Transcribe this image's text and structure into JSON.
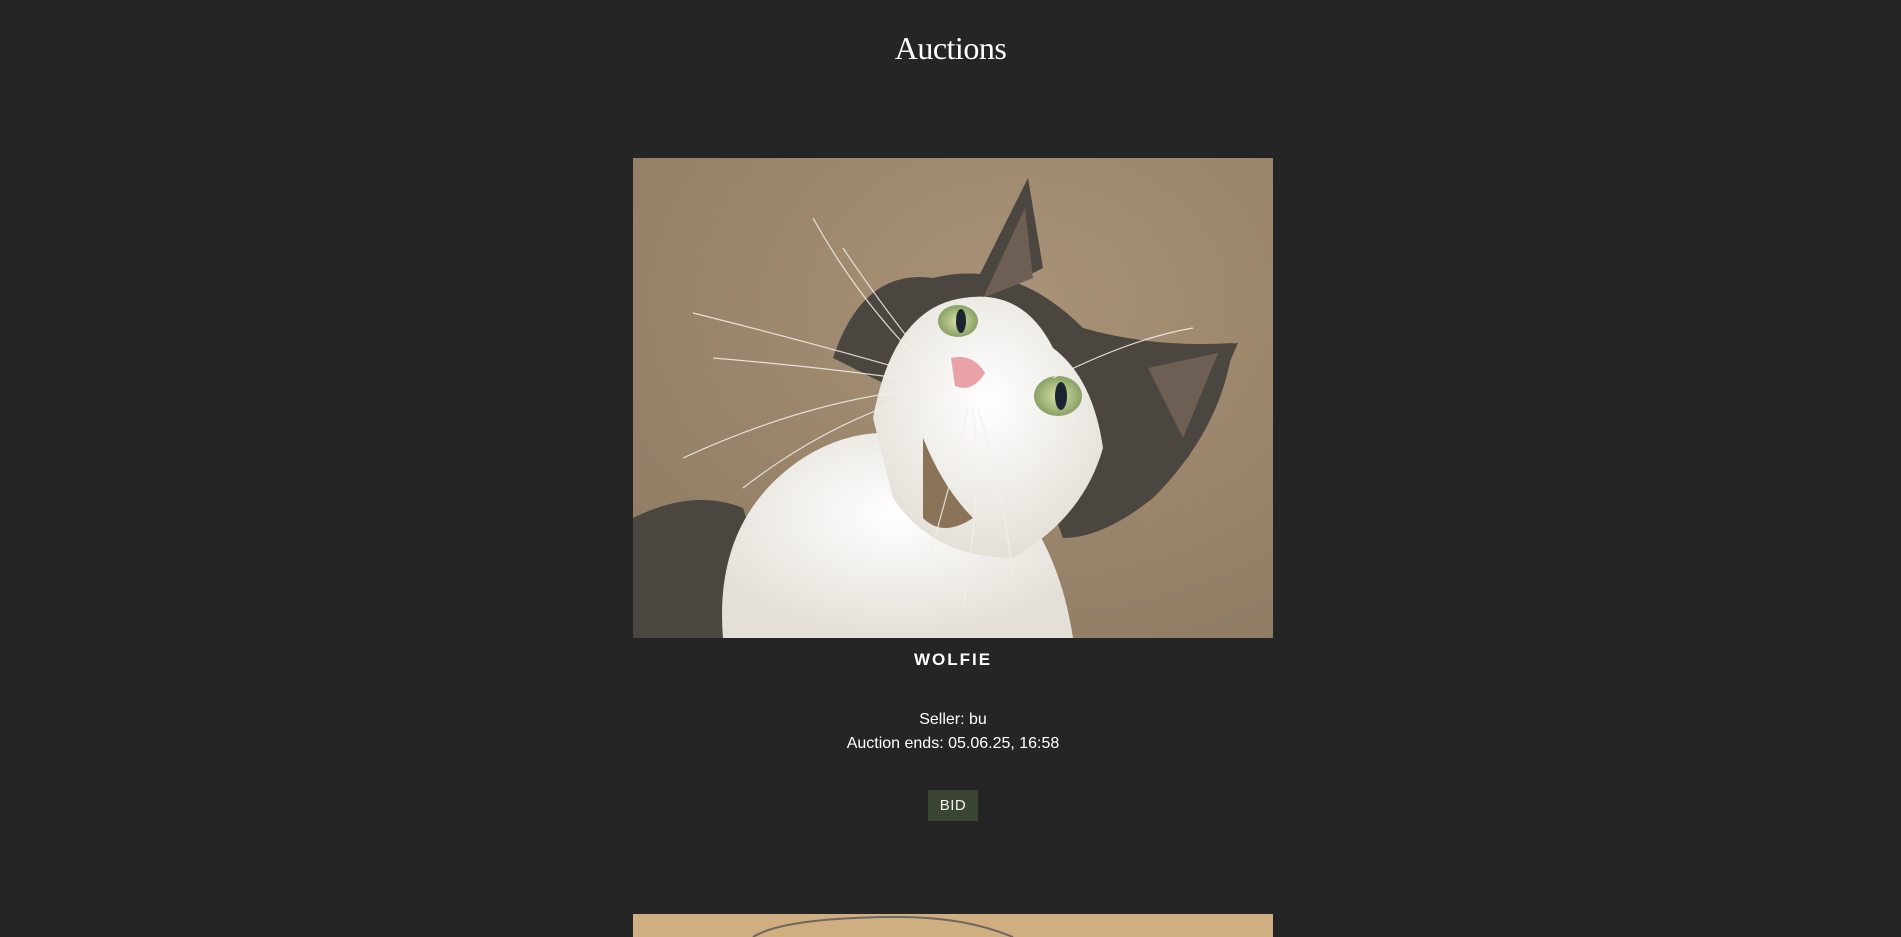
{
  "page": {
    "title": "Auctions"
  },
  "auctions": [
    {
      "name": "WOLFIE",
      "seller_label": "Seller: bu",
      "ends_label": "Auction ends: 05.06.25, 16:58",
      "bid_label": "BID",
      "image_icon": "cat-photo"
    }
  ],
  "colors": {
    "background": "#252525",
    "text": "#ffffff",
    "bid_button": "#3b4534"
  }
}
